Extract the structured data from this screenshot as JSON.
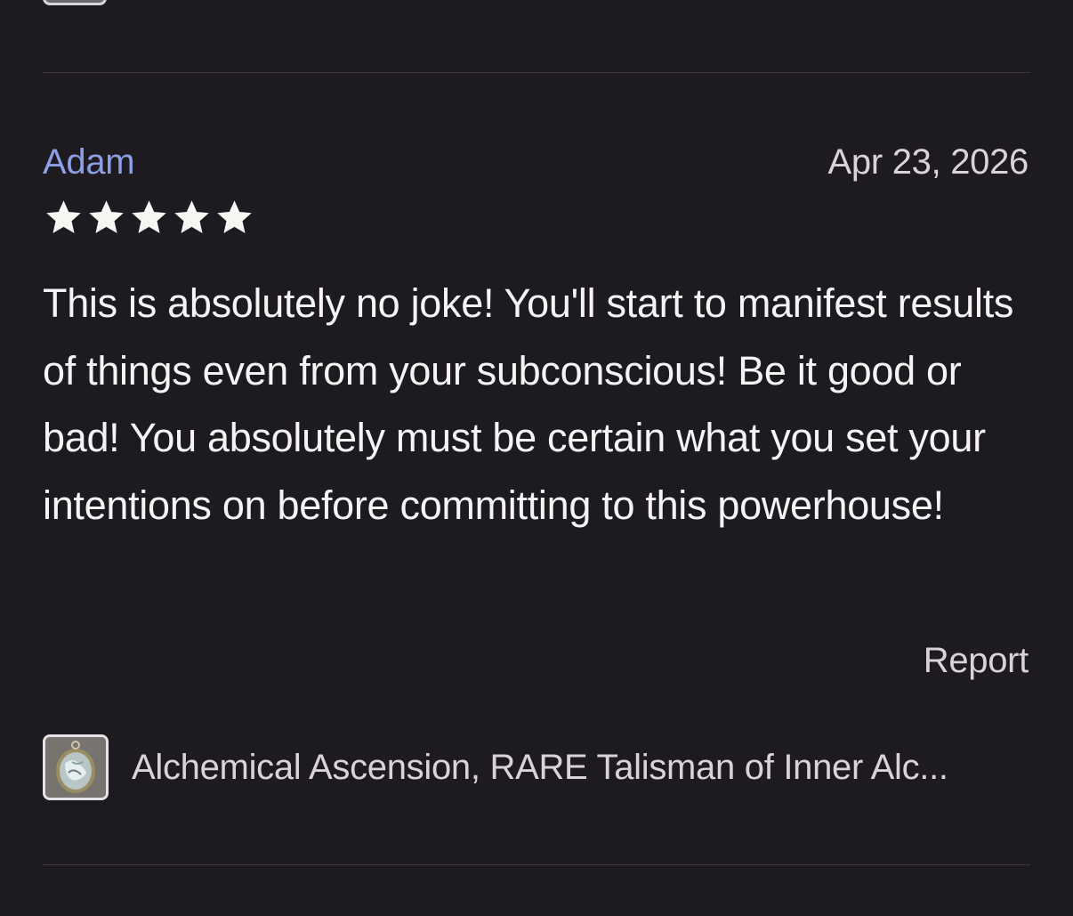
{
  "review": {
    "reviewer_name": "Adam",
    "date": "Apr 23, 2026",
    "rating": 5,
    "rating_max": 5,
    "text": "This is absolutely no joke! You'll start to manifest results of things even from your subconscious! Be it good or bad! You absolutely must be certain what you set your intentions on before committing to this powerhouse!",
    "report_label": "Report",
    "product_title": "Alchemical Ascension, RARE Talisman of Inner Alc..."
  },
  "icons": {
    "star": "star-icon",
    "product_thumbnail": "pendant-thumbnail"
  },
  "colors": {
    "background": "#1d1b20",
    "reviewer_link": "#8e9fe6",
    "star": "#f8f6f3",
    "body_text": "#f6f3f5",
    "secondary_text": "#d8d3da",
    "divider": "#3d3840"
  }
}
